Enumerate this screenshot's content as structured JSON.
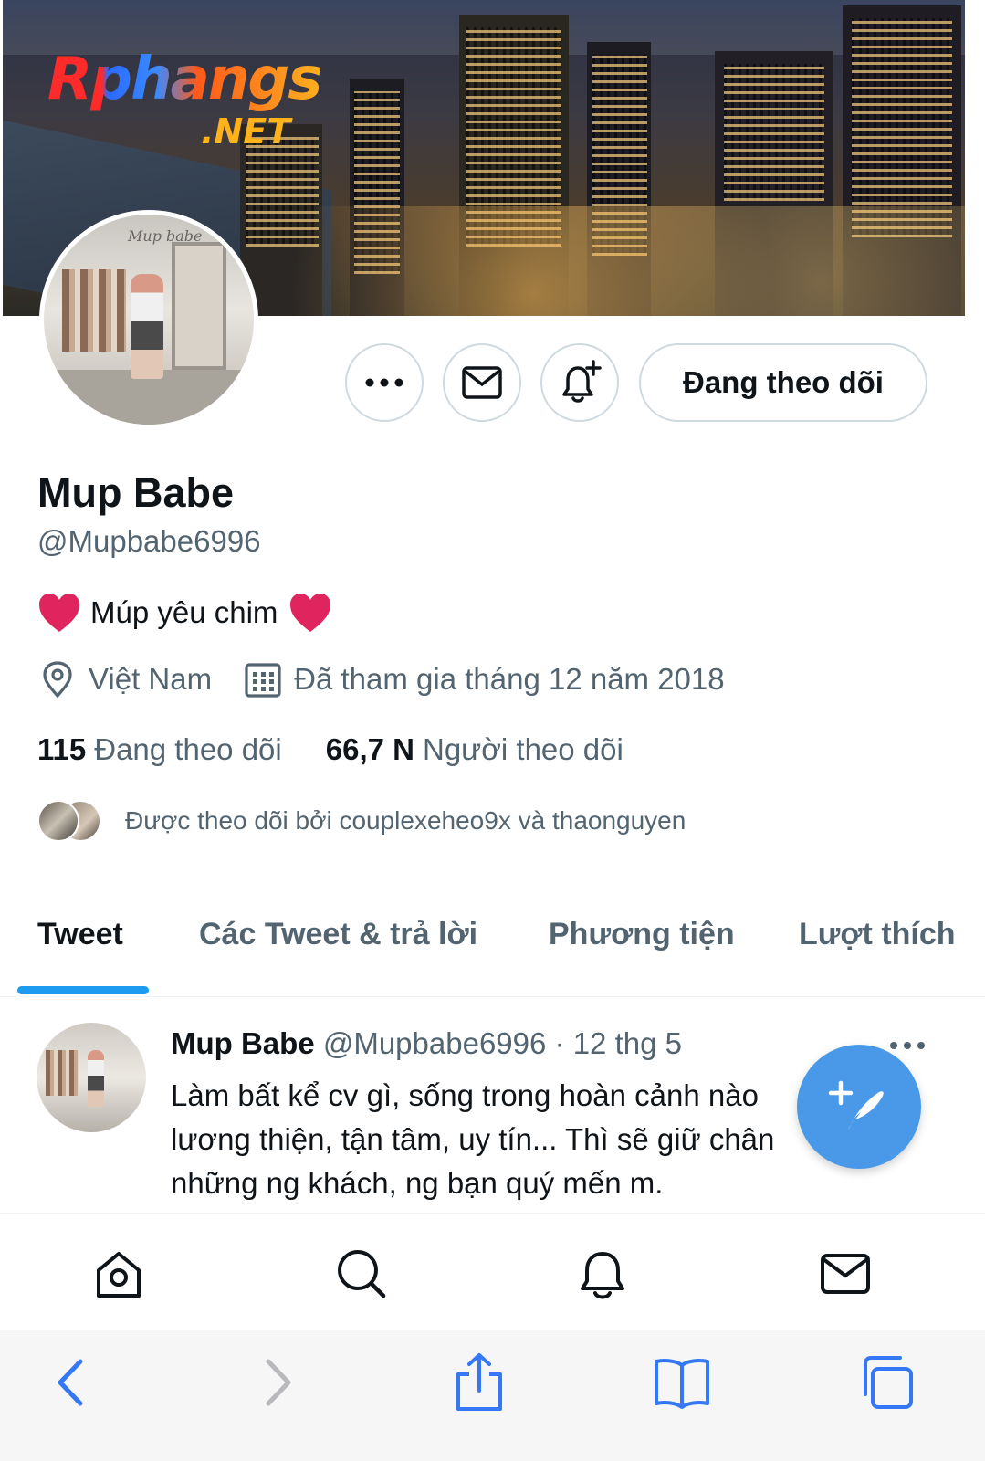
{
  "watermark": {
    "main": "Rphangs",
    "sub": ".NET"
  },
  "avatar": {
    "shop_sign": "Mup babe"
  },
  "actions": {
    "more_icon": "more-horizontal-icon",
    "message_icon": "envelope-icon",
    "notify_icon": "bell-plus-icon",
    "follow_label": "Đang theo dõi"
  },
  "profile": {
    "name": "Mup Babe",
    "handle": "@Mupbabe6996",
    "bio": "Múp yêu chim",
    "location": "Việt Nam",
    "joined": "Đã tham gia tháng 12 năm 2018",
    "following_count": "115",
    "following_label": "Đang theo dõi",
    "followers_count": "66,7 N",
    "followers_label": "Người theo dõi",
    "followed_by": "Được theo dõi bởi couplexeheo9x và thaonguyen"
  },
  "tabs": [
    {
      "label": "Tweet",
      "active": true
    },
    {
      "label": "Các Tweet & trả lời",
      "active": false
    },
    {
      "label": "Phương tiện",
      "active": false
    },
    {
      "label": "Lượt thích",
      "active": false
    }
  ],
  "tweet": {
    "name": "Mup Babe",
    "handle_date": "@Mupbabe6996 · 12 thg 5",
    "text": "Làm bất kể cv gì, sống trong hoàn cảnh nào lương thiện, tận tâm, uy tín... Thì sẽ giữ chân những ng khách, ng bạn quý mến m."
  },
  "bottom_nav": [
    "home-icon",
    "search-icon",
    "bell-icon",
    "envelope-icon"
  ],
  "safari_toolbar": [
    "back-icon",
    "forward-icon",
    "share-icon",
    "bookmarks-icon",
    "tabs-icon"
  ],
  "colors": {
    "accent": "#1d9bf0",
    "fab": "#4a99e9",
    "heart": "#e0245e",
    "secondary_text": "#536471"
  }
}
